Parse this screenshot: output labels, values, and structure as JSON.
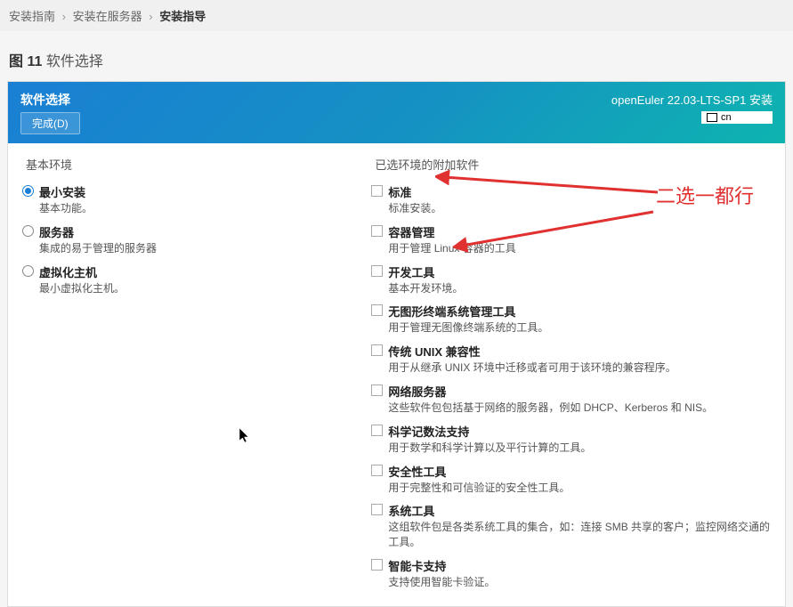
{
  "breadcrumb": {
    "items": [
      "安装指南",
      "安装在服务器",
      "安装指导"
    ]
  },
  "figure": {
    "label": "图 11",
    "title": "软件选择"
  },
  "header": {
    "title": "软件选择",
    "done_button": "完成(D)",
    "product": "openEuler 22.03-LTS-SP1 安装",
    "lang": "cn"
  },
  "left_col": {
    "heading": "基本环境",
    "items": [
      {
        "title": "最小安装",
        "desc": "基本功能。",
        "selected": true
      },
      {
        "title": "服务器",
        "desc": "集成的易于管理的服务器",
        "selected": false
      },
      {
        "title": "虚拟化主机",
        "desc": "最小虚拟化主机。",
        "selected": false
      }
    ]
  },
  "right_col": {
    "heading": "已选环境的附加软件",
    "items": [
      {
        "title": "标准",
        "desc": "标准安装。"
      },
      {
        "title": "容器管理",
        "desc": "用于管理 Linux 容器的工具"
      },
      {
        "title": "开发工具",
        "desc": "基本开发环境。"
      },
      {
        "title": "无图形终端系统管理工具",
        "desc": "用于管理无图像终端系统的工具。"
      },
      {
        "title": "传统 UNIX 兼容性",
        "desc": "用于从继承 UNIX 环境中迁移或者可用于该环境的兼容程序。"
      },
      {
        "title": "网络服务器",
        "desc": "这些软件包包括基于网络的服务器，例如 DHCP、Kerberos 和 NIS。"
      },
      {
        "title": "科学记数法支持",
        "desc": "用于数学和科学计算以及平行计算的工具。"
      },
      {
        "title": "安全性工具",
        "desc": "用于完整性和可信验证的安全性工具。"
      },
      {
        "title": "系统工具",
        "desc": "这组软件包是各类系统工具的集合，如：连接 SMB 共享的客户；监控网络交通的工具。"
      },
      {
        "title": "智能卡支持",
        "desc": "支持使用智能卡验证。"
      }
    ]
  },
  "annotation": {
    "text": "二选一都行"
  }
}
